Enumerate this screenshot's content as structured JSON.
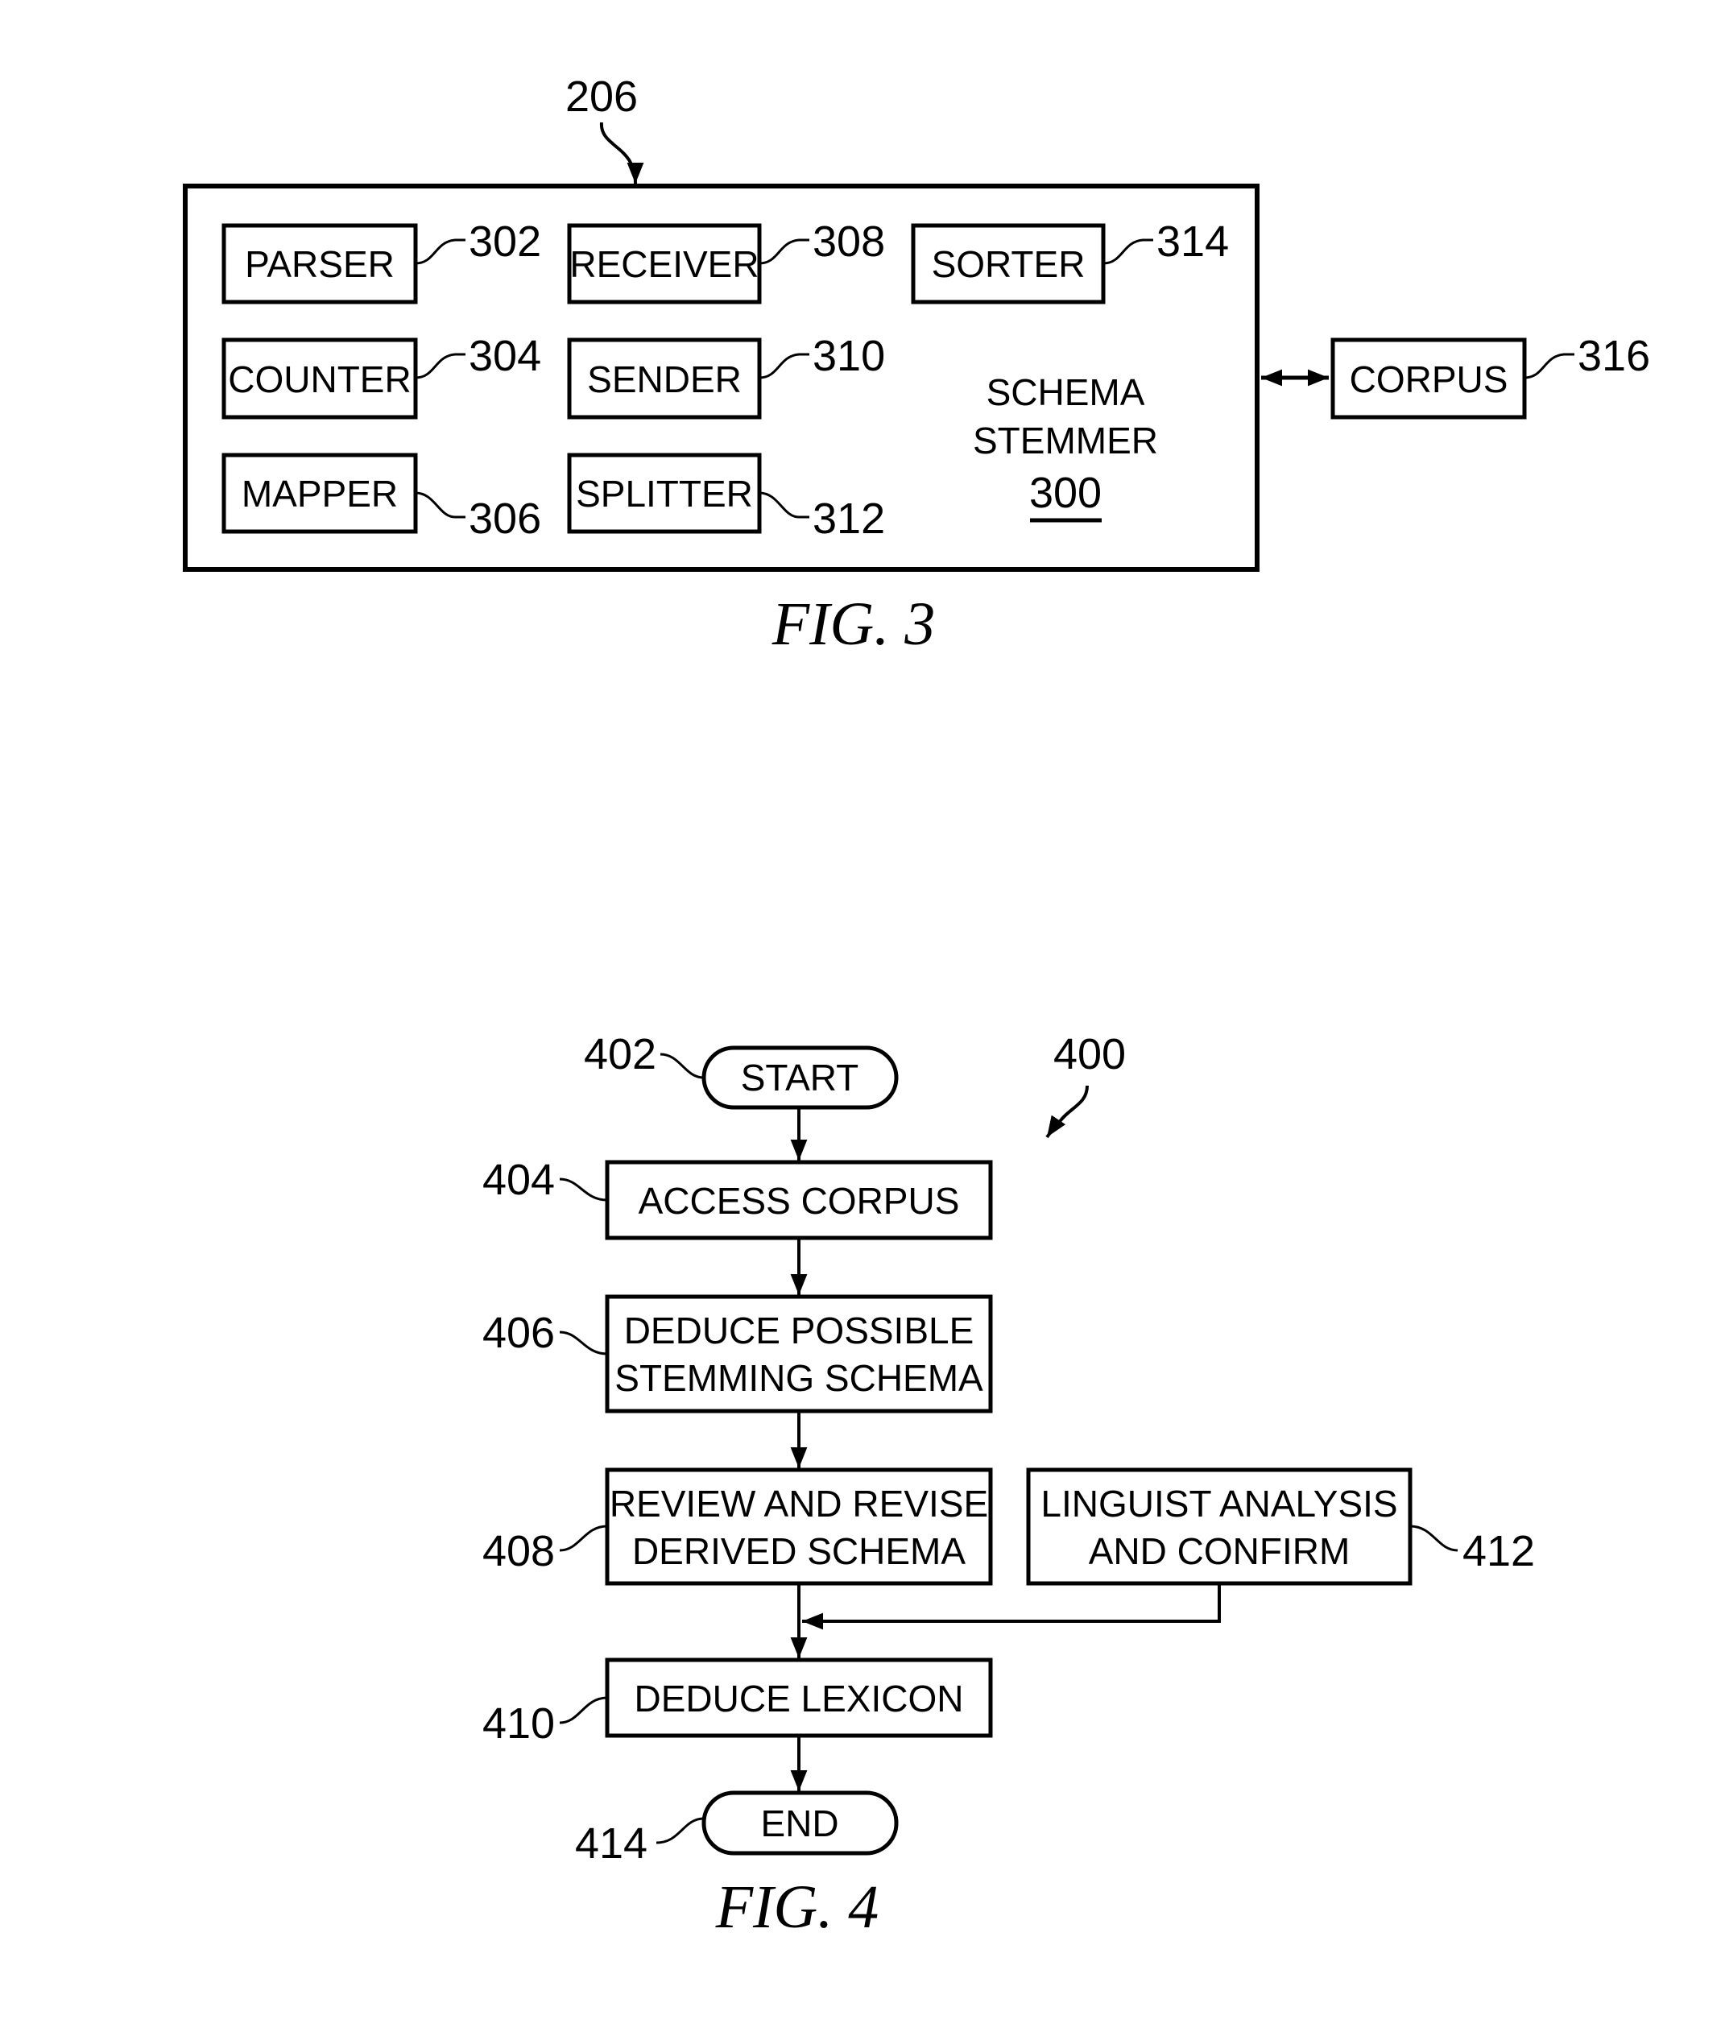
{
  "fig3": {
    "caption": "FIG. 3",
    "container_ref": "206",
    "container_title_line1": "SCHEMA",
    "container_title_line2": "STEMMER",
    "container_number": "300",
    "modules": [
      {
        "label": "PARSER",
        "ref": "302"
      },
      {
        "label": "COUNTER",
        "ref": "304"
      },
      {
        "label": "MAPPER",
        "ref": "306"
      },
      {
        "label": "RECEIVER",
        "ref": "308"
      },
      {
        "label": "SENDER",
        "ref": "310"
      },
      {
        "label": "SPLITTER",
        "ref": "312"
      },
      {
        "label": "SORTER",
        "ref": "314"
      }
    ],
    "external": {
      "label": "CORPUS",
      "ref": "316"
    }
  },
  "fig4": {
    "caption": "FIG. 4",
    "flow_ref": "400",
    "start": {
      "label": "START",
      "ref": "402"
    },
    "steps": [
      {
        "line1": "ACCESS CORPUS",
        "line2": "",
        "ref": "404"
      },
      {
        "line1": "DEDUCE POSSIBLE",
        "line2": "STEMMING SCHEMA",
        "ref": "406"
      },
      {
        "line1": "REVIEW AND REVISE",
        "line2": "DERIVED SCHEMA",
        "ref": "408"
      },
      {
        "line1": "DEDUCE LEXICON",
        "line2": "",
        "ref": "410"
      }
    ],
    "side_step": {
      "line1": "LINGUIST ANALYSIS",
      "line2": "AND CONFIRM",
      "ref": "412"
    },
    "end": {
      "label": "END",
      "ref": "414"
    }
  }
}
